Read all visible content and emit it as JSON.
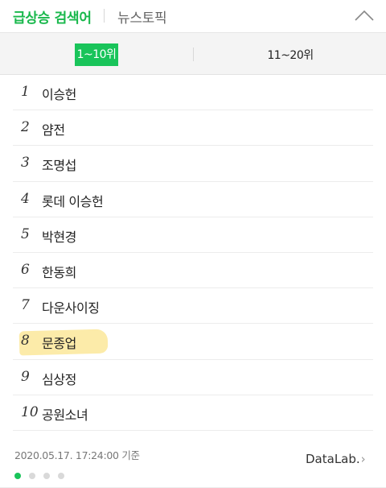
{
  "header": {
    "active_tab": "급상승 검색어",
    "inactive_tab": "뉴스토픽",
    "collapse_icon": "chevron-up-icon"
  },
  "rank_tabs": {
    "left": "1~10위",
    "right": "11~20위"
  },
  "items": [
    {
      "rank": "1",
      "keyword": "이승헌"
    },
    {
      "rank": "2",
      "keyword": "얌전"
    },
    {
      "rank": "3",
      "keyword": "조명섭"
    },
    {
      "rank": "4",
      "keyword": "롯데 이승헌"
    },
    {
      "rank": "5",
      "keyword": "박현경"
    },
    {
      "rank": "6",
      "keyword": "한동희"
    },
    {
      "rank": "7",
      "keyword": "다운사이징"
    },
    {
      "rank": "8",
      "keyword": "문종업"
    },
    {
      "rank": "9",
      "keyword": "심상정"
    },
    {
      "rank": "10",
      "keyword": "공원소녀"
    }
  ],
  "footer": {
    "timestamp": "2020.05.17. 17:24:00 기준",
    "datalab": "DataLab.",
    "chevron": "›",
    "page_count": 4,
    "active_page": 1
  },
  "colors": {
    "accent": "#19c45a",
    "highlight": "#fbe79a"
  }
}
